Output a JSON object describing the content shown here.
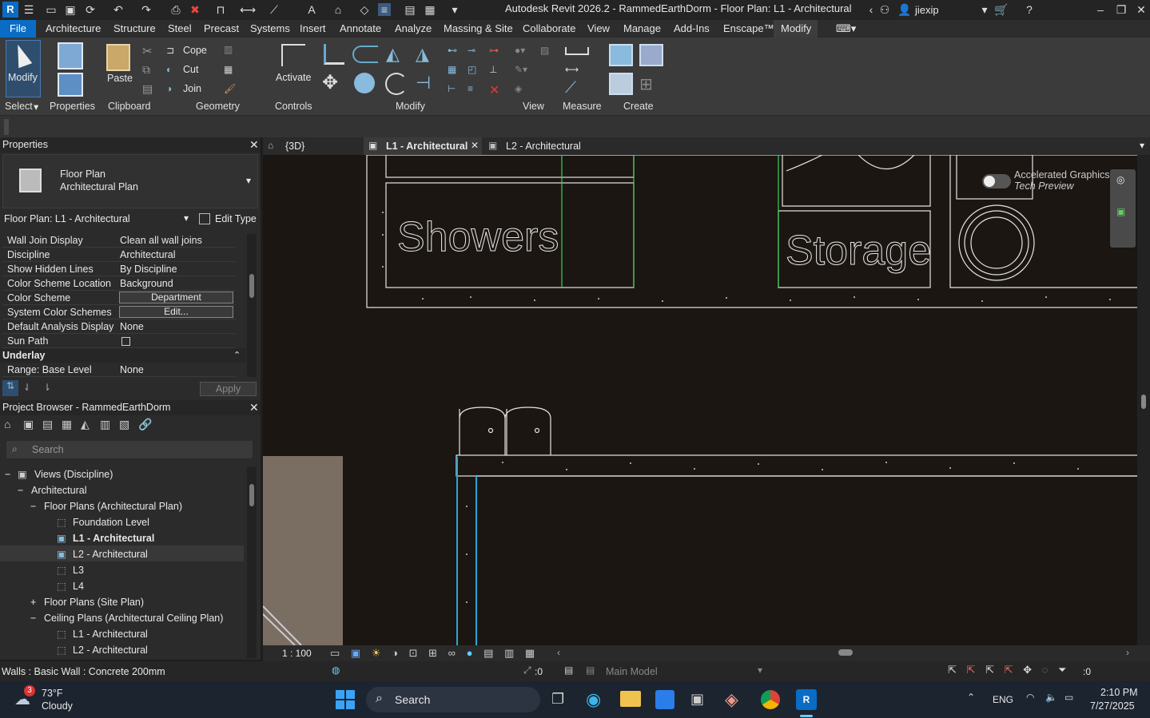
{
  "title": "Autodesk Revit 2026.2 - RammedEarthDorm - Floor Plan: L1 - Architectural",
  "user": "jiexip",
  "menu": {
    "file": "File",
    "tabs": [
      "Architecture",
      "Structure",
      "Steel",
      "Precast",
      "Systems",
      "Insert",
      "Annotate",
      "Analyze",
      "Massing & Site",
      "Collaborate",
      "View",
      "Manage",
      "Add-Ins",
      "Enscape™",
      "Modify"
    ]
  },
  "ribbon": {
    "modify": "Modify",
    "select": "Select",
    "properties": "Properties",
    "paste": "Paste",
    "clipboard": "Clipboard",
    "cope": "Cope",
    "cut": "Cut",
    "join": "Join",
    "geometry": "Geometry",
    "activate": "Activate",
    "controls": "Controls",
    "modify_group": "Modify",
    "view_group": "View",
    "measure": "Measure",
    "create": "Create"
  },
  "properties": {
    "header": "Properties",
    "type_line1": "Floor Plan",
    "type_line2": "Architectural Plan",
    "selector": "Floor Plan: L1 - Architectural",
    "edit_type": "Edit Type",
    "rows": [
      {
        "k": "Wall Join Display",
        "v": "Clean all wall joins"
      },
      {
        "k": "Discipline",
        "v": "Architectural"
      },
      {
        "k": "Show Hidden Lines",
        "v": "By Discipline"
      },
      {
        "k": "Color Scheme Location",
        "v": "Background"
      },
      {
        "k": "Color Scheme",
        "v": "Department"
      },
      {
        "k": "System Color Schemes",
        "v": "Edit..."
      },
      {
        "k": "Default Analysis Display ...",
        "v": "None"
      },
      {
        "k": "Sun Path",
        "v": ""
      }
    ],
    "section": "Underlay",
    "range_k": "Range: Base Level",
    "range_v": "None",
    "apply": "Apply"
  },
  "browser": {
    "header": "Project Browser - RammedEarthDorm",
    "search_placeholder": "Search",
    "nodes": [
      {
        "label": "Views (Discipline)",
        "expander": "−"
      },
      {
        "label": "Architectural",
        "expander": "−"
      },
      {
        "label": "Floor Plans (Architectural Plan)",
        "expander": "−"
      },
      {
        "label": "Foundation Level",
        "expander": ""
      },
      {
        "label": "L1 - Architectural",
        "expander": ""
      },
      {
        "label": "L2 - Architectural",
        "expander": ""
      },
      {
        "label": "L3",
        "expander": ""
      },
      {
        "label": "L4",
        "expander": ""
      },
      {
        "label": "Floor Plans (Site Plan)",
        "expander": "+"
      },
      {
        "label": "Ceiling Plans (Architectural Ceiling Plan)",
        "expander": "−"
      },
      {
        "label": "L1 - Architectural",
        "expander": ""
      },
      {
        "label": "L2 - Architectural",
        "expander": ""
      }
    ]
  },
  "view_tabs": [
    {
      "label": "{3D}"
    },
    {
      "label": "L1 - Architectural"
    },
    {
      "label": "L2 - Architectural"
    }
  ],
  "canvas": {
    "room1": "Showers",
    "room2": "Storage",
    "toggle_line1": "Accelerated Graphics",
    "toggle_line2": "Tech Preview"
  },
  "viewbar": {
    "scale": "1 : 100"
  },
  "status": {
    "left": "Walls : Basic Wall : Concrete 200mm",
    "count_a": ":0",
    "model": "Main Model",
    "filter": ":0"
  },
  "taskbar": {
    "temp": "73°F",
    "weather": "Cloudy",
    "badge": "3",
    "search": "Search",
    "lang": "ENG",
    "time": "2:10 PM",
    "date": "7/27/2025"
  }
}
